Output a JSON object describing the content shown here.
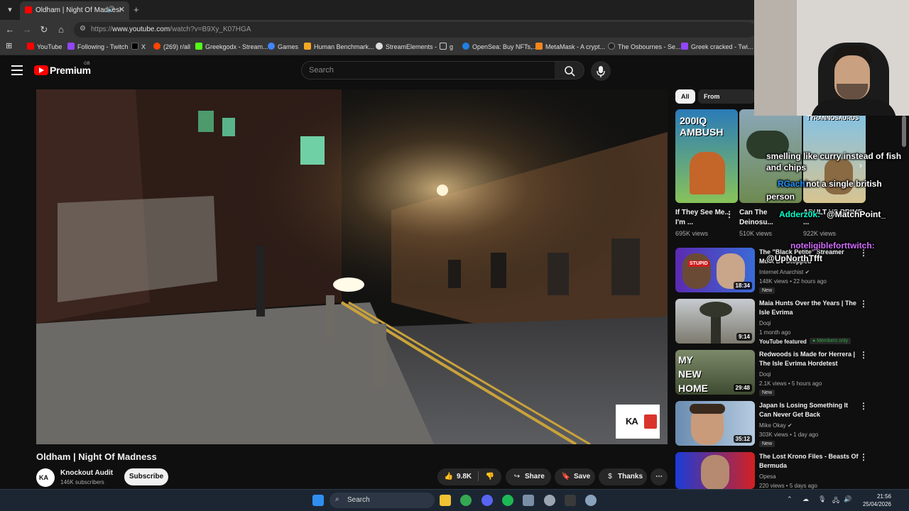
{
  "browser": {
    "tab_title": "Oldham | Night Of Madness",
    "url_prefix": "https://",
    "url_host": "www.youtube.com",
    "url_path": "/watch?v=B9Xy_K07HGA",
    "bookmarks": [
      {
        "label": "YouTube",
        "color": "#ff0000"
      },
      {
        "label": "Following - Twitch",
        "color": "#9146ff"
      },
      {
        "label": "X",
        "color": "#000000"
      },
      {
        "label": "(269) r/all",
        "color": "#ff4500"
      },
      {
        "label": "Greekgodx - Stream...",
        "color": "#53fc18"
      },
      {
        "label": "Games",
        "color": "#4285f4"
      },
      {
        "label": "Human Benchmark...",
        "color": "#f5a623"
      },
      {
        "label": "StreamElements -",
        "color": "#dddddd"
      },
      {
        "label": "g",
        "color": "#aaaaaa"
      },
      {
        "label": "OpenSea: Buy NFTs,...",
        "color": "#2081e2"
      },
      {
        "label": "MetaMask - A crypt...",
        "color": "#f6851b"
      },
      {
        "label": "The Osbournes - Se...",
        "color": "#222222"
      },
      {
        "label": "Greek cracked - Twi...",
        "color": "#9146ff"
      }
    ]
  },
  "youtube": {
    "brand": "Premium",
    "region": "GB",
    "search_placeholder": "Search"
  },
  "video": {
    "title": "Oldham | Night Of Madness",
    "watermark": "KA",
    "channel_initials": "KA",
    "channel_name": "Knockout Audit",
    "subscribers": "146K subscribers",
    "subscribe_label": "Subscribe",
    "likes": "9.8K",
    "share_label": "Share",
    "save_label": "Save",
    "thanks_label": "Thanks"
  },
  "sidebar": {
    "chips": [
      "All",
      "From Knockout A"
    ],
    "shorts": [
      {
        "title": "If They See Me... I'm ...",
        "views": "695K views",
        "thumb_text": "200IQ AMBUSH"
      },
      {
        "title": "Can The Deinosu...",
        "views": "510K views"
      },
      {
        "title": "ADULT VS PRIME ...",
        "views": "922K views",
        "thumb_text": "TYRANNOSAURUS"
      }
    ],
    "videos": [
      {
        "title": "The \"Black Petite\" Streamer Must Be Stopped",
        "channel": "Internet Anarchist",
        "meta": "148K views • 22 hours ago",
        "badge": "New",
        "duration": "18:34",
        "thumb_text": "STUPID"
      },
      {
        "title": "Maia Hunts Over the Years | The Isle Evrima",
        "channel": "Doqi",
        "meta": "1 month ago",
        "badge": "YouTube featured",
        "badge2": "Members only",
        "duration": "9:14"
      },
      {
        "title": "Redwoods is Made for Herrera | The Isle Evrima Hordetest",
        "channel": "Doqi",
        "meta": "2.1K views • 5 hours ago",
        "badge": "New",
        "duration": "29:48",
        "thumb_text": "MY NEW HOME"
      },
      {
        "title": "Japan Is Losing Something It Can Never Get Back",
        "channel": "Mike Okay",
        "meta": "303K views • 1 day ago",
        "badge": "New",
        "duration": "35:12"
      },
      {
        "title": "The Lost Krono Files - Beasts Of Bermuda",
        "channel": "Opesa",
        "meta": "220 views • 5 days ago",
        "duration": ""
      }
    ]
  },
  "chat_overlay": {
    "line1": "smelling like curry instead of fish",
    "line2": "and chips",
    "user1": "RGachi:",
    "msg1": "not a single british",
    "msg1b": "person",
    "user2": "Adderz0k:",
    "msg2": "@MatchPoint_",
    "user3": "noteligibleforttwitch:",
    "msg3": "@UpNorthTfft"
  },
  "taskbar": {
    "search_label": "Search",
    "time": "21:56",
    "date": "25/04/2026"
  }
}
